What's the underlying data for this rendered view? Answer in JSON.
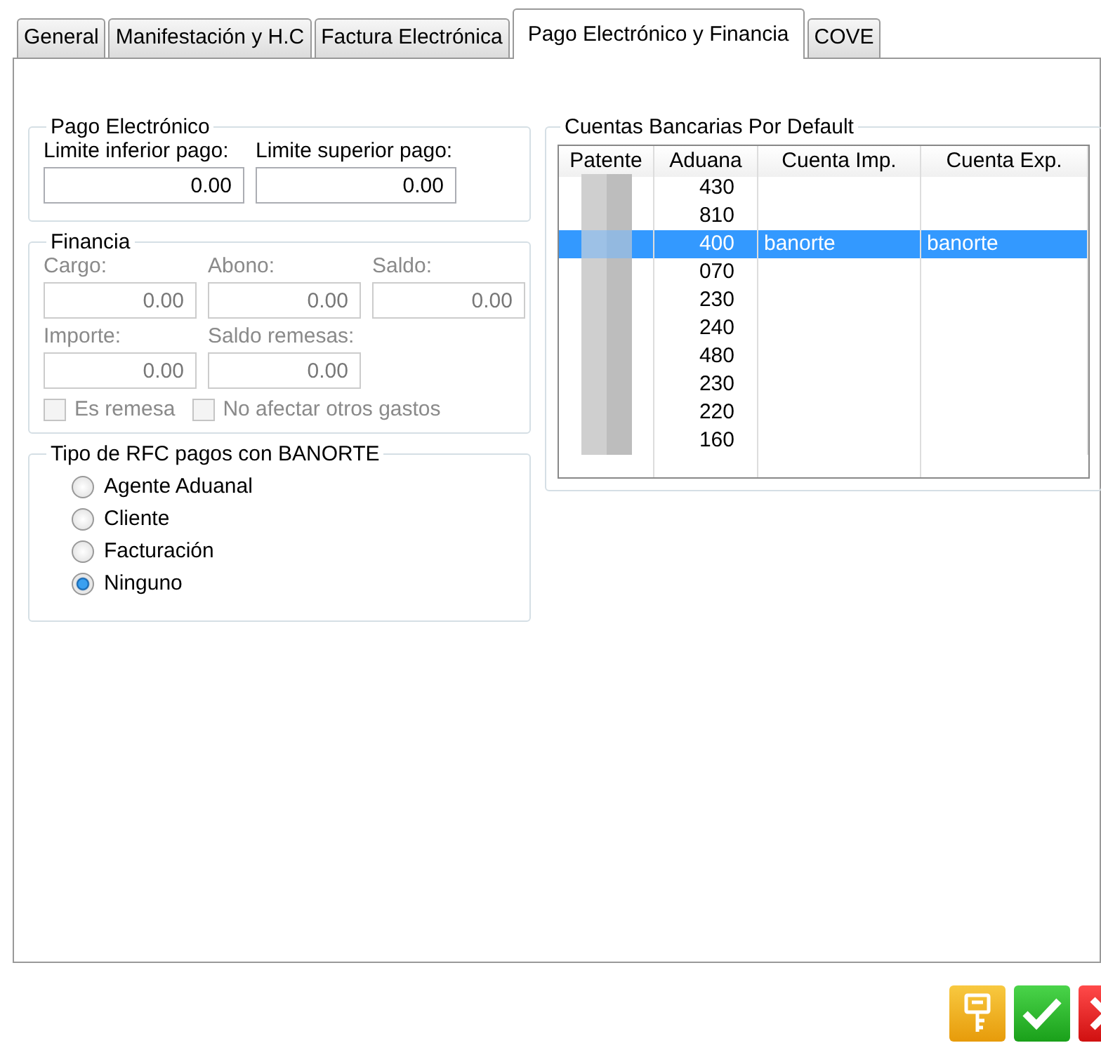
{
  "tabs": [
    {
      "label": "General",
      "selected": false
    },
    {
      "label": "Manifestación y H.C",
      "selected": false
    },
    {
      "label": "Factura Electrónica",
      "selected": false
    },
    {
      "label": "Pago Electrónico y Financia",
      "selected": true
    },
    {
      "label": "COVE",
      "selected": false
    }
  ],
  "pago_electronico": {
    "title": "Pago Electrónico",
    "fields": [
      {
        "label": "Limite inferior pago:",
        "value": "0.00",
        "disabled": false
      },
      {
        "label": "Limite superior pago:",
        "value": "0.00",
        "disabled": false
      }
    ]
  },
  "financia": {
    "title": "Financia",
    "rows": [
      [
        {
          "label": "Cargo:",
          "value": "0.00",
          "disabled": true
        },
        {
          "label": "Abono:",
          "value": "0.00",
          "disabled": true
        },
        {
          "label": "Saldo:",
          "value": "0.00",
          "disabled": true
        }
      ],
      [
        {
          "label": "Importe:",
          "value": "0.00",
          "disabled": true
        },
        {
          "label": "Saldo remesas:",
          "value": "0.00",
          "disabled": true
        }
      ]
    ],
    "checkboxes": [
      {
        "label": "Es remesa",
        "checked": false,
        "disabled": true
      },
      {
        "label": "No afectar otros gastos",
        "checked": false,
        "disabled": true
      }
    ]
  },
  "tipo_rfc": {
    "title": "Tipo de RFC pagos con BANORTE",
    "options": [
      {
        "label": "Agente Aduanal",
        "selected": false
      },
      {
        "label": "Cliente",
        "selected": false
      },
      {
        "label": "Facturación",
        "selected": false
      },
      {
        "label": "Ninguno",
        "selected": true
      }
    ]
  },
  "cuentas": {
    "title": "Cuentas  Bancarias Por Default",
    "columns": [
      "Patente",
      "Aduana",
      "Cuenta Imp.",
      "Cuenta Exp."
    ],
    "rows": [
      {
        "aduana": "430",
        "selected": false
      },
      {
        "aduana": "810",
        "selected": false
      },
      {
        "aduana": "400",
        "cuenta_imp": "banorte",
        "cuenta_exp": "banorte",
        "selected": true
      },
      {
        "aduana": "070",
        "selected": false
      },
      {
        "aduana": "230",
        "selected": false
      },
      {
        "aduana": "240",
        "selected": false
      },
      {
        "aduana": "480",
        "selected": false
      },
      {
        "aduana": "230",
        "selected": false
      },
      {
        "aduana": "220",
        "selected": false
      },
      {
        "aduana": "160",
        "selected": false
      }
    ]
  },
  "buttons": [
    {
      "kind": "key"
    },
    {
      "kind": "accept"
    },
    {
      "kind": "cancel"
    }
  ]
}
